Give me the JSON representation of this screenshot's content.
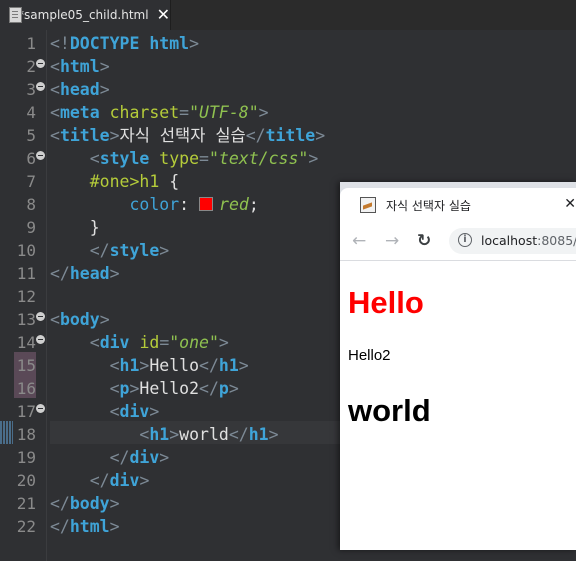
{
  "editor": {
    "tab": {
      "label": "*sample05_child.html",
      "close": "✕"
    },
    "lines": [
      "1",
      "2",
      "3",
      "4",
      "5",
      "6",
      "7",
      "8",
      "9",
      "10",
      "11",
      "12",
      "13",
      "14",
      "15",
      "16",
      "17",
      "18",
      "19",
      "20",
      "21",
      "22"
    ],
    "code": {
      "l1": {
        "open": "<!",
        "doctype": "DOCTYPE",
        "rest": " html",
        "close": ">"
      },
      "l2": {
        "tag": "html"
      },
      "l3": {
        "tag": "head"
      },
      "l4": {
        "tag": "meta",
        "attr": "charset",
        "eq": "=",
        "val": "\"UTF-8\""
      },
      "l5": {
        "tag": "title",
        "text": "자식 선택자 실습"
      },
      "l6": {
        "tag": "style",
        "attr": "type",
        "eq": "=",
        "val": "\"text/css\""
      },
      "l7": {
        "selector": "#one>h1",
        "brace": " {"
      },
      "l8": {
        "prop": "color",
        "colon": ":",
        "val": "red",
        "semi": ";",
        "swatch": "#ff0000"
      },
      "l9": {
        "brace": "}"
      },
      "l10": {
        "tag": "style"
      },
      "l11": {
        "tag": "head"
      },
      "l13": {
        "tag": "body"
      },
      "l14": {
        "tag": "div",
        "attr": "id",
        "eq": "=",
        "val": "\"one\""
      },
      "l15": {
        "tag": "h1",
        "text": "Hello"
      },
      "l16": {
        "tag": "p",
        "text": "Hello2"
      },
      "l17": {
        "tag": "div"
      },
      "l18": {
        "tag": "h1",
        "text": "world"
      },
      "l19": {
        "tag": "div"
      },
      "l20": {
        "tag": "div"
      },
      "l21": {
        "tag": "body"
      },
      "l22": {
        "tag": "html"
      }
    }
  },
  "browser": {
    "tab_title": "자식 선택자 실습",
    "tab_close": "✕",
    "nav": {
      "back": "←",
      "forward": "→",
      "reload": "↻",
      "info": "i"
    },
    "url": {
      "host": "localhost",
      "port": ":8085/"
    },
    "page": {
      "h1_hello": "Hello",
      "p_hello2": "Hello2",
      "h1_world": "world"
    },
    "colors": {
      "h1_color": "#ff0000"
    }
  }
}
